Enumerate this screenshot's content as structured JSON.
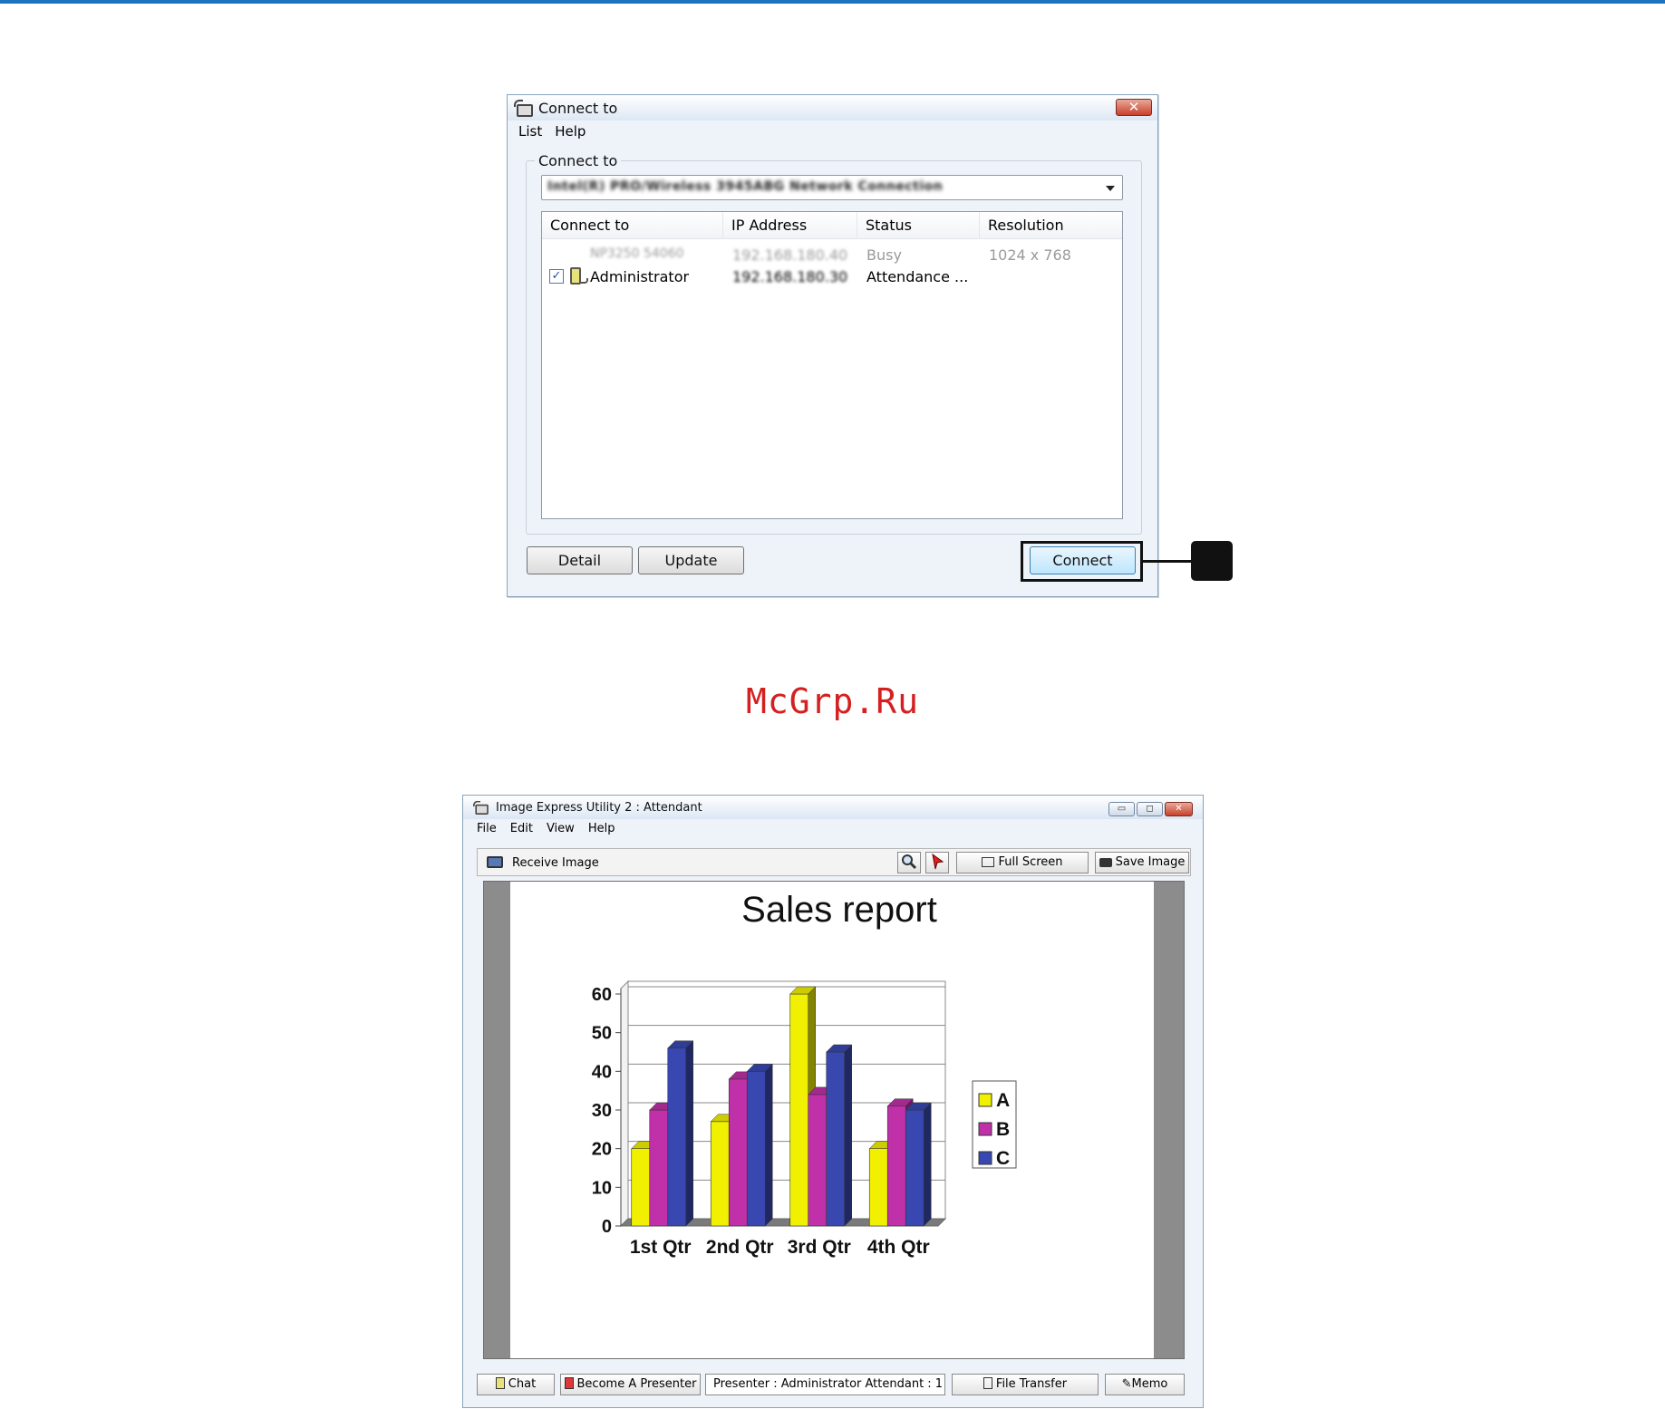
{
  "connect_window": {
    "title": "Connect to",
    "menu": [
      "List",
      "Help"
    ],
    "group_label": "Connect to",
    "adapter": "Intel(R) PRO/Wireless 3945ABG Network Connection",
    "columns": [
      "Connect to",
      "IP Address",
      "Status",
      "Resolution"
    ],
    "rows": [
      {
        "name": "NP3250 54060",
        "ip": "192.168.180.40",
        "status": "Busy",
        "resolution": "1024 x 768",
        "checked": false
      },
      {
        "name": "Administrator",
        "ip": "192.168.180.30",
        "status": "Attendance ...",
        "resolution": "",
        "checked": true
      }
    ],
    "buttons": {
      "detail": "Detail",
      "update": "Update",
      "connect": "Connect"
    },
    "close_glyph": "✕"
  },
  "watermark": "McGrp.Ru",
  "viewer_window": {
    "title": "Image Express Utility 2 : Attendant",
    "menu": [
      "File",
      "Edit",
      "View",
      "Help"
    ],
    "toolbar": {
      "receive": "Receive Image",
      "full_screen": "Full Screen",
      "save_image": "Save Image"
    },
    "status": {
      "chat": "Chat",
      "become_presenter": "Become A Presenter",
      "presenter_info": "Presenter : Administrator    Attendant : 1",
      "file_transfer": "File Transfer",
      "memo": "Memo"
    },
    "controls": {
      "minimize": "▭",
      "maximize": "◻",
      "close": "✕"
    }
  },
  "chart_data": {
    "type": "bar",
    "title": "Sales report",
    "categories": [
      "1st Qtr",
      "2nd Qtr",
      "3rd Qtr",
      "4th Qtr"
    ],
    "series": [
      {
        "name": "A",
        "color": "#f0f000",
        "values": [
          20,
          27,
          60,
          20
        ]
      },
      {
        "name": "B",
        "color": "#c030a8",
        "values": [
          30,
          38,
          34,
          31
        ]
      },
      {
        "name": "C",
        "color": "#3848b0",
        "values": [
          46,
          40,
          45,
          30
        ]
      }
    ],
    "ylim": [
      0,
      60
    ],
    "yticks": [
      0,
      10,
      20,
      30,
      40,
      50,
      60
    ],
    "grid": true,
    "legend": "right",
    "style": "3d-column"
  }
}
